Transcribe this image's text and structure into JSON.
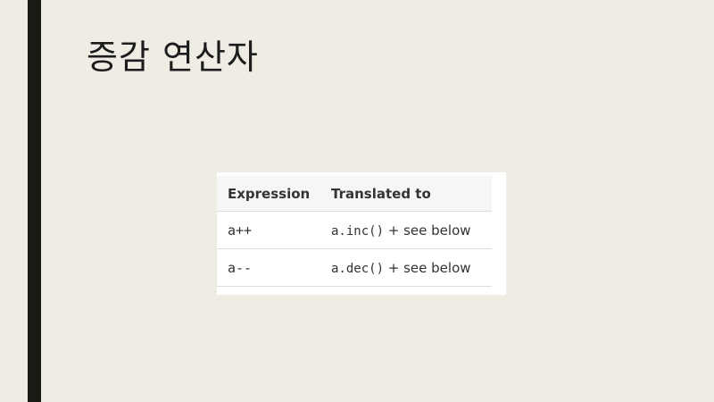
{
  "slide": {
    "title": "증감 연산자"
  },
  "table": {
    "headers": [
      "Expression",
      "Translated to"
    ],
    "rows": [
      {
        "expression": "a++",
        "code": "a.inc()",
        "note": " + see below"
      },
      {
        "expression": "a--",
        "code": "a.dec()",
        "note": " + see below"
      }
    ]
  }
}
